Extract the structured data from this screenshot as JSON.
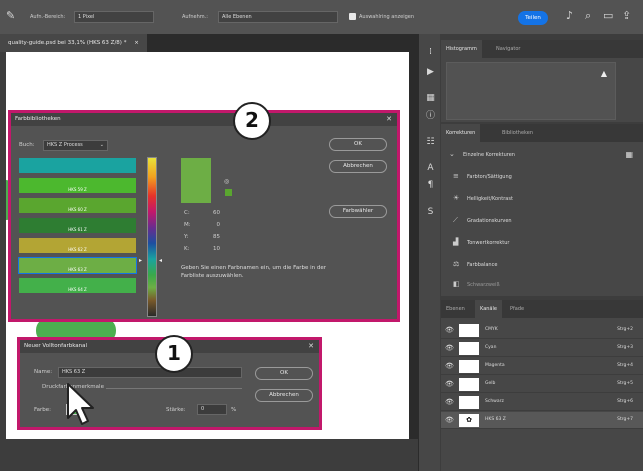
{
  "topbar": {
    "tolerance_label": "Aufn.-Bereich:",
    "tolerance_value": "1 Pixel",
    "sample_label": "Aufnehm.:",
    "sample_value": "Alle Ebenen",
    "show_ring_label": "Auswahlring anzeigen",
    "share_label": "Teilen"
  },
  "document": {
    "tab_title": "quality-guide.psd bei 33,1% (HKS 63 Z/8) *",
    "tab_close": "×"
  },
  "panels": {
    "histogram_tab": "Histogramm",
    "navigator_tab": "Navigator",
    "corrections_tab": "Korrekturen",
    "libraries_tab": "Bibliotheken",
    "single_corrections": "Einzelne Korrekturen",
    "adjustments": [
      {
        "label": "Farbton/Sättigung",
        "icon": "≡"
      },
      {
        "label": "Helligkeit/Kontrast",
        "icon": "☀"
      },
      {
        "label": "Gradationskurven",
        "icon": "⟋"
      },
      {
        "label": "Tonwertkorrektur",
        "icon": "▟"
      },
      {
        "label": "Farbbalance",
        "icon": "⚖"
      },
      {
        "label": "Schwarzweiß",
        "icon": "◧"
      }
    ],
    "layers_tab": "Ebenen",
    "channels_tab": "Kanäle",
    "paths_tab": "Pfade",
    "channels": [
      {
        "name": "CMYK",
        "shortcut": "Strg+2"
      },
      {
        "name": "Cyan",
        "shortcut": "Strg+3"
      },
      {
        "name": "Magenta",
        "shortcut": "Strg+4"
      },
      {
        "name": "Gelb",
        "shortcut": "Strg+5"
      },
      {
        "name": "Schwarz",
        "shortcut": "Strg+6"
      },
      {
        "name": "HKS 63 Z",
        "shortcut": "Strg+7"
      }
    ]
  },
  "library_dialog": {
    "title": "Farbbibliotheken",
    "book_label": "Buch:",
    "book_value": "HKS Z Process",
    "ok": "OK",
    "cancel": "Abbrechen",
    "picker": "Farbwähler",
    "swatches": [
      {
        "name": "",
        "color": "#1aa3a0"
      },
      {
        "name": "HKS 59 Z",
        "color": "#4cb82e"
      },
      {
        "name": "HKS 60 Z",
        "color": "#5aa62f"
      },
      {
        "name": "HKS 61 Z",
        "color": "#2e7d32"
      },
      {
        "name": "HKS 62 Z",
        "color": "#b3a534"
      },
      {
        "name": "HKS 63 Z",
        "color": "#6dae45"
      },
      {
        "name": "HKS 64 Z",
        "color": "#43b04a"
      }
    ],
    "preview_color": "#6dae45",
    "cmyk": [
      {
        "label": "C:",
        "value": "60"
      },
      {
        "label": "M:",
        "value": "0"
      },
      {
        "label": "Y:",
        "value": "85"
      },
      {
        "label": "K:",
        "value": "10"
      }
    ],
    "hint": "Geben Sie einen Farbnamen ein, um die Farbe in der Farbliste auszuwählen."
  },
  "spot_dialog": {
    "title": "Neuer Volltonfarbkanal",
    "name_label": "Name:",
    "name_value": "HKS 63 Z",
    "ink_label": "Druckfarbenmerkmale",
    "color_label": "Farbe:",
    "solidity_label": "Stärke:",
    "solidity_value": "0",
    "percent": "%",
    "ok": "OK",
    "cancel": "Abbrechen",
    "swatch_color": "#4caf50"
  },
  "badges": {
    "one": "1",
    "two": "2"
  },
  "colors": {
    "accent": "#c2186b",
    "share": "#1473e6"
  }
}
